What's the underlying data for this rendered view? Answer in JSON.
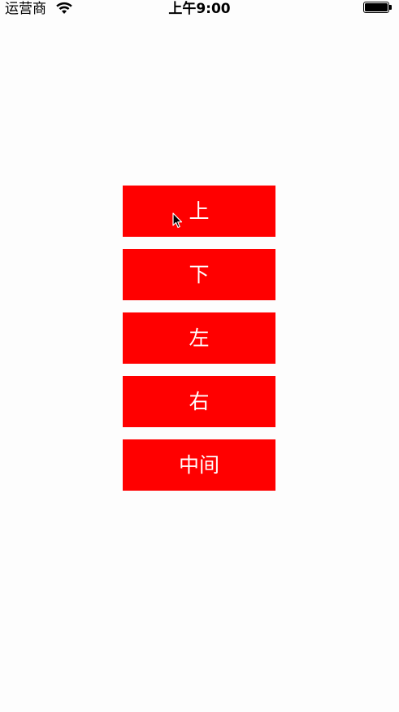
{
  "status_bar": {
    "carrier": "运营商",
    "wifi_icon": "wifi-icon",
    "time": "上午9:00",
    "battery_icon": "battery-icon",
    "battery_level": 1.0
  },
  "buttons": [
    {
      "label": "上"
    },
    {
      "label": "下"
    },
    {
      "label": "左"
    },
    {
      "label": "右"
    },
    {
      "label": "中间"
    }
  ],
  "colors": {
    "button_bg": "#ff0000",
    "button_text": "#ffffff",
    "page_bg": "#fdfdfd"
  }
}
